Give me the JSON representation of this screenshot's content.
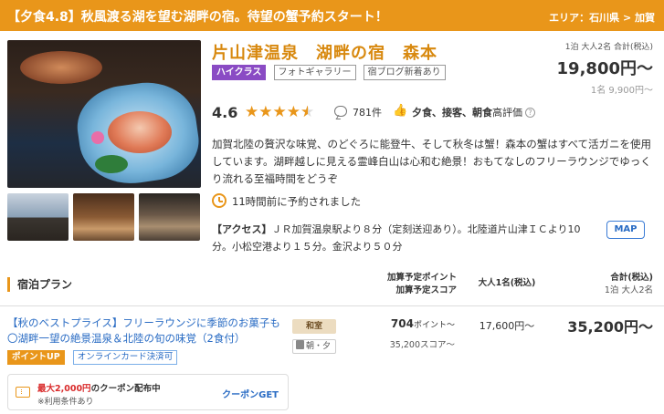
{
  "colors": {
    "accent": "#e9961a",
    "link": "#2a6cc4",
    "high_class": "#8a4bc4",
    "coupon_red": "#d92b2b"
  },
  "banner": {
    "title": "【夕食4.8】秋風渡る湖を望む湖畔の宿。待望の蟹予約スタート！",
    "area": "エリア：石川県 > 加賀"
  },
  "hotel": {
    "name": "片山津温泉　湖畔の宿　森本",
    "tags": [
      "ハイクラス",
      "フォトギャラリー",
      "宿ブログ新着あり"
    ]
  },
  "price": {
    "label": "1泊 大人2名 合計(税込)",
    "total": "19,800円〜",
    "per_person": "1名 9,900円〜"
  },
  "rating": {
    "score": "4.6",
    "stars_value": 4.6,
    "review_count": "781件",
    "highlight_items": "夕食、接客、朝食",
    "highlight_suffix": "高評価"
  },
  "description": "加賀北陸の贅沢な味覚、のどぐろに能登牛、そして秋冬は蟹！森本の蟹はすべて活ガニを使用しています。湖畔越しに見える霊峰白山は心和む絶景！おもてなしのフリーラウンジでゆっくり流れる至福時間をどうぞ",
  "reserved": "11時間前に予約されました",
  "access": {
    "label": "【アクセス】",
    "text": "ＪＲ加賀温泉駅より８分（定刻送迎あり）。北陸道片山津ＩＣより10分。小松空港より１５分。金沢より５０分"
  },
  "map_button": "MAP",
  "plans": {
    "section_title": "宿泊プラン",
    "col_points_line1": "加算予定ポイント",
    "col_points_line2": "加算予定スコア",
    "col_adult": "大人1名(税込)",
    "col_total_line1": "合計(税込)",
    "col_total_line2": "1泊 大人2名",
    "items": [
      {
        "name": "【秋のベストプライス】フリーラウンジに季節のお菓子も〇湖畔一望の絶景温泉＆北陸の旬の味覚（2食付）",
        "room_type": "和室",
        "meal": "朝・夕",
        "points": "704",
        "points_unit": "ポイント〜",
        "score": "35,200スコア〜",
        "adult_price": "17,600円〜",
        "total_price": "35,200円〜",
        "badges": [
          "ポイントUP",
          "オンラインカード決済可"
        ]
      }
    ]
  },
  "coupon": {
    "amount_red": "最大2,000円",
    "amount_suffix": "のクーポン配布中",
    "note": "※利用条件あり",
    "button": "クーポンGET"
  }
}
